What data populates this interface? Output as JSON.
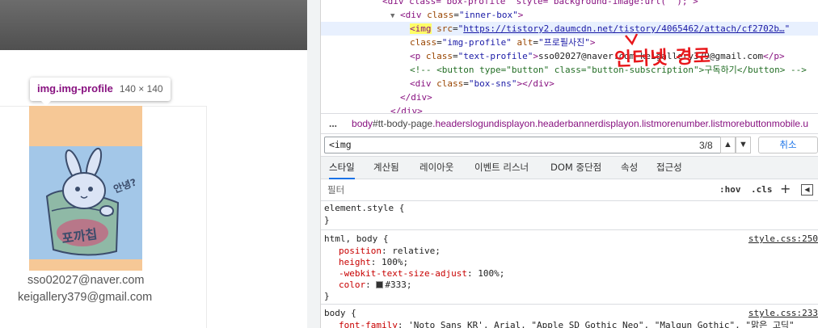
{
  "page": {
    "tooltip": {
      "selector": "img.img-profile",
      "dimensions": "140 × 140"
    },
    "emails": [
      "sso02027@naver.com",
      "keigallery379@gmail.com"
    ],
    "image_alt": "프로필사진",
    "image_text": {
      "greeting": "안녕?",
      "sign": "포까칩"
    }
  },
  "devtools": {
    "dom_lines": [
      {
        "text_tag_open": "<div class=\"box-profile\" style=\"background-image:url('');\">"
      },
      {
        "tag": "div",
        "cls": "inner-box"
      },
      {
        "src": "https://tistory2.daumcdn.net/tistory/4065462/attach/cf2702b…",
        "tag_hl": "<img",
        "src_attr": "src"
      },
      {
        "cls_attr": "class",
        "cls_val": "img-profile",
        "alt_attr": "alt",
        "alt_val": "프로필사진"
      },
      {
        "p_cls": "text-profile",
        "p_text": "sso02027@naver.com keigallery379@gmail.com"
      },
      {
        "comment": "<!-- <button type=\"button\" class=\"button-subscription\">구독하기</button> -->"
      },
      {
        "box_cls": "box-sns"
      },
      {
        "close": "</div>"
      },
      {
        "close": "</div>"
      }
    ],
    "annotation": "인터넷 경로",
    "breadcrumb": {
      "tag": "body",
      "id": "#tt-body-page",
      "classes": ".headerslogundisplayon.headerbannerdisplayon.listmorenumber.listmorebuttonmobile.u"
    },
    "search": {
      "value": "<img",
      "count": "3/8",
      "prev": "▲",
      "next": "▼",
      "cancel": "취소"
    },
    "tabs": [
      "스타일",
      "계산됨",
      "레이아웃",
      "이벤트 리스너",
      "DOM 중단점",
      "속성",
      "접근성"
    ],
    "filter": {
      "placeholder": "필터",
      "hov": ":hov",
      "cls": ".cls",
      "plus": "+"
    },
    "styles": {
      "element_style": "element.style {",
      "rule1": {
        "selector": "html, body {",
        "source": "style.css:250",
        "decls": [
          {
            "prop": "position",
            "val": "relative;"
          },
          {
            "prop": "height",
            "val": "100%;"
          },
          {
            "prop": "-webkit-text-size-adjust",
            "val": "100%;"
          },
          {
            "prop": "color",
            "val": "#333;"
          }
        ]
      },
      "rule2": {
        "selector": "body {",
        "source": "style.css:233",
        "decl": {
          "prop": "font-family",
          "val": "'Noto Sans KR', Arial, \"Apple SD Gothic Neo\", \"Malgun Gothic\", \"맑은 고딕\""
        }
      },
      "close": "}"
    }
  },
  "colors": {
    "tag": "#881280",
    "attr_name": "#994500",
    "attr_value": "#1a1aa6",
    "comment": "#236e25",
    "annotation": "#e8171b",
    "highlight_margin": "#f6c896",
    "image_bg": "#a3c7e8",
    "accent": "#1a73e8"
  }
}
